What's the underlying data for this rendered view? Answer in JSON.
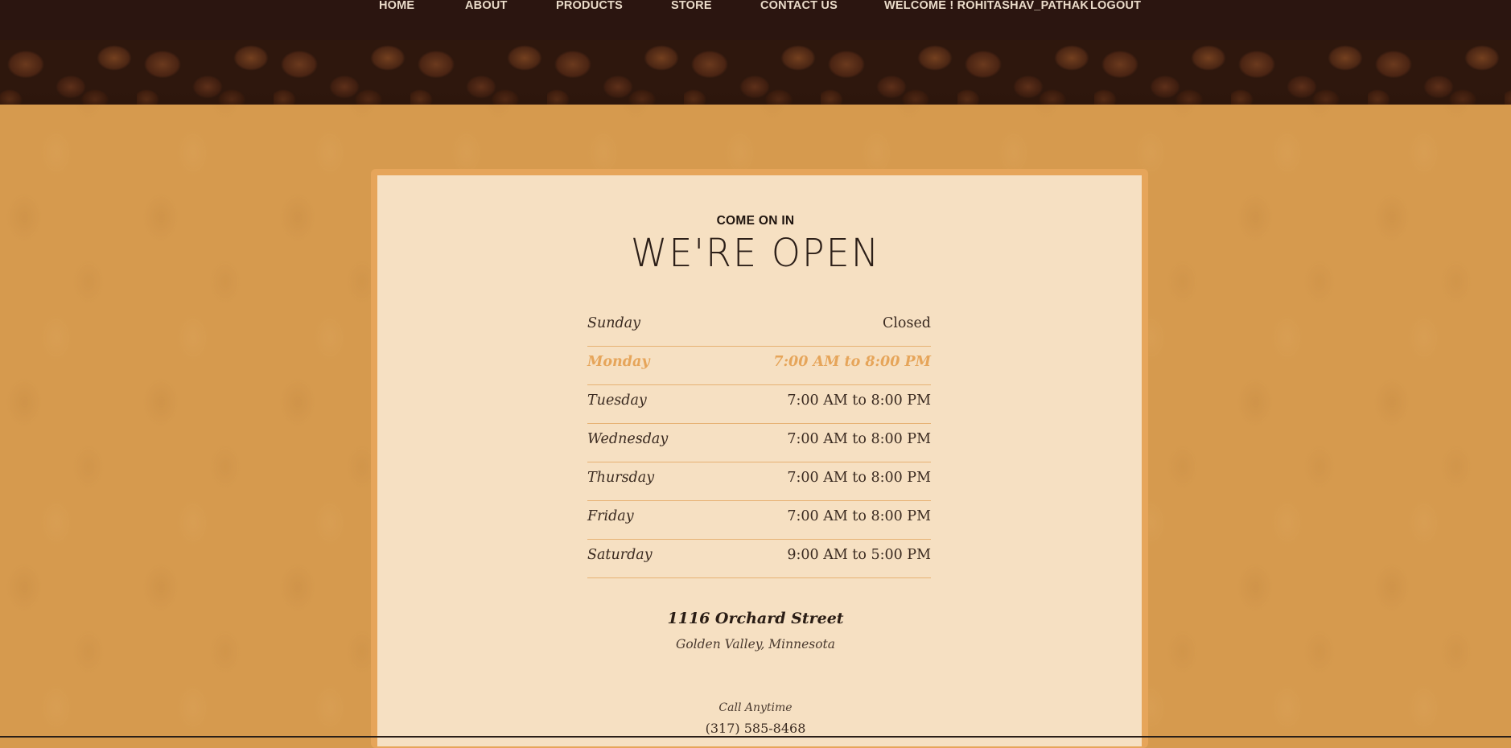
{
  "nav": {
    "items": [
      {
        "label": "HOME"
      },
      {
        "label": "ABOUT"
      },
      {
        "label": "PRODUCTS"
      },
      {
        "label": "STORE"
      },
      {
        "label": "CONTACT US"
      }
    ],
    "welcome": "WELCOME ! ROHITASHAV_PATHAK",
    "logout": "LOGOUT"
  },
  "section": {
    "eyebrow": "COME ON IN",
    "headline": "WE'RE OPEN"
  },
  "hours": [
    {
      "day": "Sunday",
      "time": "Closed"
    },
    {
      "day": "Monday",
      "time": "7:00 AM to 8:00 PM",
      "today": true
    },
    {
      "day": "Tuesday",
      "time": "7:00 AM to 8:00 PM"
    },
    {
      "day": "Wednesday",
      "time": "7:00 AM to 8:00 PM"
    },
    {
      "day": "Thursday",
      "time": "7:00 AM to 8:00 PM"
    },
    {
      "day": "Friday",
      "time": "7:00 AM to 8:00 PM"
    },
    {
      "day": "Saturday",
      "time": "9:00 AM to 5:00 PM"
    }
  ],
  "address": {
    "street": "1116 Orchard Street",
    "city": "Golden Valley, Minnesota"
  },
  "contact": {
    "call_label": "Call Anytime",
    "phone": "(317) 585-8468"
  },
  "colors": {
    "page_bg": "#d69a4e",
    "nav_bg": "#2b1510",
    "card_bg": "#f6e0c2",
    "accent": "#e6a55a"
  }
}
